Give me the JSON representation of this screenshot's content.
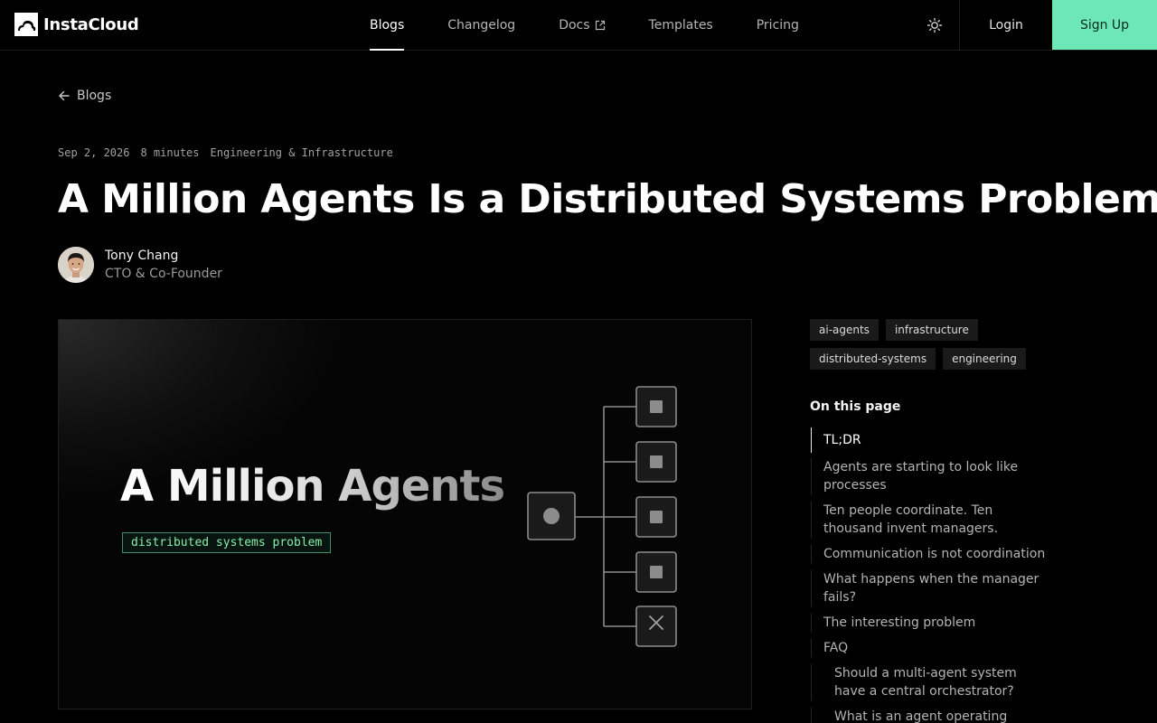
{
  "header": {
    "brand": "InstaCloud",
    "nav": [
      {
        "label": "Blogs",
        "active": true
      },
      {
        "label": "Changelog",
        "active": false
      },
      {
        "label": "Docs",
        "active": false,
        "external": true
      },
      {
        "label": "Templates",
        "active": false
      },
      {
        "label": "Pricing",
        "active": false
      }
    ],
    "theme_icon": "sun-icon",
    "login_label": "Login",
    "signup_label": "Sign Up"
  },
  "back_link": {
    "label": "Blogs",
    "icon": "arrow-left-icon"
  },
  "post": {
    "date": "Sep 2, 2026",
    "read_time": "8 minutes",
    "category": "Engineering & Infrastructure",
    "title": "A Million Agents Is a Distributed Systems Problem",
    "author": {
      "name": "Tony Chang",
      "role": "CTO & Co-Founder"
    },
    "hero": {
      "title": "A Million Agents",
      "badge": "distributed systems problem"
    }
  },
  "tags": [
    "ai-agents",
    "infrastructure",
    "distributed-systems",
    "engineering"
  ],
  "toc": {
    "heading": "On this page",
    "items": [
      {
        "label": "TL;DR",
        "active": true,
        "level": 1
      },
      {
        "label": "Agents are starting to look like processes",
        "level": 1
      },
      {
        "label": "Ten people coordinate. Ten thousand invent managers.",
        "level": 1
      },
      {
        "label": "Communication is not coordination",
        "level": 1
      },
      {
        "label": "What happens when the manager fails?",
        "level": 1
      },
      {
        "label": "The interesting problem",
        "level": 1
      },
      {
        "label": "FAQ",
        "level": 1
      },
      {
        "label": "Should a multi-agent system have a central orchestrator?",
        "level": 2
      },
      {
        "label": "What is an agent operating",
        "level": 2
      }
    ]
  },
  "colors": {
    "accent": "#6ee7b7",
    "background": "#000000",
    "badge_text": "#86efac"
  }
}
